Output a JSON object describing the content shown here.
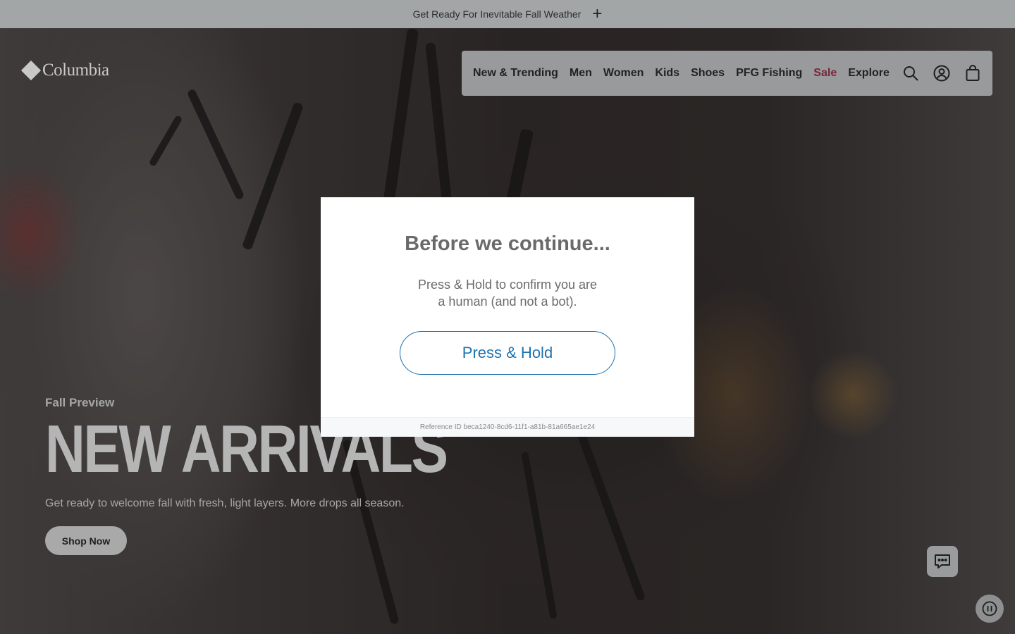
{
  "promo": {
    "text": "Get Ready For Inevitable Fall Weather",
    "icon": "plus-icon"
  },
  "brand": {
    "name": "Columbia",
    "icon": "columbia-diamond-logo"
  },
  "nav": {
    "links": [
      "New & Trending",
      "Men",
      "Women",
      "Kids",
      "Shoes",
      "PFG Fishing",
      "Sale",
      "Explore"
    ],
    "sale_color": "#7b2438",
    "icons": [
      "search-icon",
      "account-icon",
      "shopping-bag-icon"
    ]
  },
  "hero": {
    "eyebrow": "Fall Preview",
    "headline": "NEW ARRIVALS",
    "subtitle": "Get ready to welcome fall with fresh, light layers. More drops all season.",
    "cta": "Shop Now"
  },
  "modal": {
    "title": "Before we continue...",
    "message_line1": "Press & Hold to confirm you are",
    "message_line2": "a human (and not a bot).",
    "button": "Press & Hold",
    "accent": "#1f73b0",
    "reference": "Reference ID beca1240-8cd6-11f1-a81b-81a665ae1e24"
  },
  "floating": {
    "chat_icon": "chat-icon",
    "pause_icon": "pause-icon"
  }
}
